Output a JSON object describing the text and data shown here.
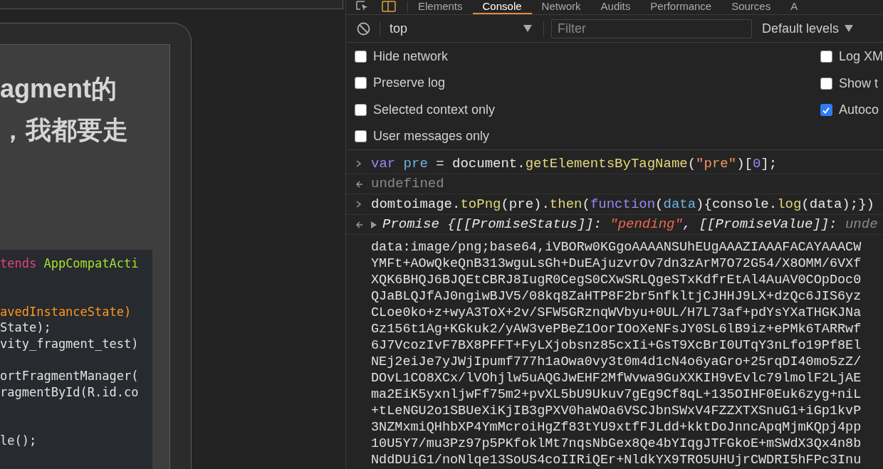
{
  "preview": {
    "heading_lines": [
      "agment的",
      "，我都要走"
    ],
    "code_lines": [
      {
        "kind": "code",
        "tokens": [
          {
            "kind": "keyword",
            "text": "tends "
          },
          {
            "kind": "type",
            "text": "AppCompatActi"
          }
        ]
      },
      {
        "kind": "blank"
      },
      {
        "kind": "blank"
      },
      {
        "kind": "code",
        "tokens": [
          {
            "kind": "param",
            "text": "avedInstanceState)"
          }
        ]
      },
      {
        "kind": "code",
        "tokens": [
          {
            "kind": "plain",
            "text": "State);"
          }
        ]
      },
      {
        "kind": "code",
        "tokens": [
          {
            "kind": "plain",
            "text": "vity_fragment_test)"
          }
        ]
      },
      {
        "kind": "blank"
      },
      {
        "kind": "code",
        "tokens": [
          {
            "kind": "plain",
            "text": "ortFragmentManager("
          }
        ]
      },
      {
        "kind": "code",
        "tokens": [
          {
            "kind": "plain",
            "text": "ragmentById(R.id.co"
          }
        ]
      },
      {
        "kind": "blank"
      },
      {
        "kind": "blank"
      },
      {
        "kind": "code",
        "tokens": [
          {
            "kind": "plain",
            "text": "le();"
          }
        ]
      }
    ]
  },
  "devtools": {
    "tabs": [
      {
        "label": "Elements",
        "selected": false
      },
      {
        "label": "Console",
        "selected": true
      },
      {
        "label": "Network",
        "selected": false
      },
      {
        "label": "Audits",
        "selected": false
      },
      {
        "label": "Performance",
        "selected": false
      },
      {
        "label": "Sources",
        "selected": false
      },
      {
        "label": "A",
        "selected": false
      }
    ],
    "toolbar": {
      "context": "top",
      "filter_placeholder": "Filter",
      "levels": "Default levels"
    },
    "settings_left": [
      {
        "label": "Hide network",
        "checked": false
      },
      {
        "label": "Preserve log",
        "checked": false
      },
      {
        "label": "Selected context only",
        "checked": false
      },
      {
        "label": "User messages only",
        "checked": false
      }
    ],
    "settings_right": [
      {
        "label": "Log XM",
        "checked": false
      },
      {
        "label": "Show t",
        "checked": false
      },
      {
        "label": "Autoco",
        "checked": true
      }
    ],
    "console": [
      {
        "kind": "input",
        "tokens": [
          {
            "kind": "keyword",
            "text": "var "
          },
          {
            "kind": "variable",
            "text": "pre"
          },
          {
            "kind": "plain",
            "text": " = document."
          },
          {
            "kind": "method",
            "text": "getElementsByTagName"
          },
          {
            "kind": "plain",
            "text": "("
          },
          {
            "kind": "string",
            "text": "\"pre\""
          },
          {
            "kind": "plain",
            "text": ")["
          },
          {
            "kind": "number",
            "text": "0"
          },
          {
            "kind": "plain",
            "text": "];"
          }
        ]
      },
      {
        "kind": "result",
        "tokens": [
          {
            "kind": "muted",
            "text": "undefined"
          }
        ]
      },
      {
        "kind": "input",
        "tokens": [
          {
            "kind": "plain",
            "text": "domtoimage."
          },
          {
            "kind": "method",
            "text": "toPng"
          },
          {
            "kind": "plain",
            "text": "(pre)."
          },
          {
            "kind": "method",
            "text": "then"
          },
          {
            "kind": "plain",
            "text": "("
          },
          {
            "kind": "keyword",
            "text": "function"
          },
          {
            "kind": "plain",
            "text": "("
          },
          {
            "kind": "variable",
            "text": "data"
          },
          {
            "kind": "plain",
            "text": "){console."
          },
          {
            "kind": "method",
            "text": "log"
          },
          {
            "kind": "plain",
            "text": "(data);})"
          }
        ]
      },
      {
        "kind": "promise",
        "tokens": [
          {
            "kind": "plain",
            "text": "Promise {[[PromiseStatus]]: "
          },
          {
            "kind": "status",
            "text": "\"pending\""
          },
          {
            "kind": "plain",
            "text": ", [[PromiseValue]]: "
          },
          {
            "kind": "muted",
            "text": "unde"
          }
        ]
      }
    ],
    "log_lines": [
      "data:image/png;base64,iVBORw0KGgoAAAANSUhEUgAAAZIAAAFACAYAAACW",
      "YMFt+AOwQkeQnB313wguLsGh+DuEAjuzvrOv7dn3zArM7O72G54/X8OMM/6VXf",
      "XQK6BHQJ6BJQEtCBRJ8IugR0CegS0CXwSRLQgeSTxKdfrEtAl4AuAV0COpDoc0",
      "QJaBLQJfAJ0ngiwBJV5/08kq8ZaHTP8F2br5nfkltjCJHHJ9LX+dzQc6JIS6yz",
      "CLoe0ko+z+wyA3ToX+2v/SFW5GRznqWVbyu+0UL/H7L73af+pdYsYXaTHGKJNa",
      "Gz156t1Ag+KGkuk2/yAW3vePBeZ1OorIOoXeNFsJY0SL6lB9iz+ePMk6TARRwf",
      "6J7VcozIvF7BX8PFFT+FyLXjobsnz85cxIi+GsT9XcBrI0UTqY3nLfo19Pf8El",
      "NEj2eiJe7yJWjIpumf777h1aOwa0vy3t0m4d1cN4o6yaGro+25rqDI40mo5zZ/",
      "DOvL1CO8XCx/lVOhjlw5uAQGJwEHF2MfWvwa9GuXXKIH9vEvlc79lmolF2LjAE",
      "ma2EiK5yxnljwFf75m2+pvXL5bU9Ukuv7gEg9Cf8qL+135OIHF0Euk6zyg+niL",
      "+tLeNGU2o1SBUeXiKjIB3gPXV0haWOa6VSCJbnSWxV4FZZXTXSnuG1+iGp1kvP",
      "3NZMxmiQHhbXP4YmMcroiHgZf83tYU9xtfFJLdd+kktDoJnncApqMjmKQpj4pp",
      "10U5Y7/mu3Pz97p5PKfoklMt7nqsNbGex8Qe4bYIqgJTFGkoE+mSWdX3Qx4n8b",
      "NddDUiG1/noNlqe13SoUS4coIIRiQEr+NldkYX9TRO5UHUjrCWDRI5hFPc3Inu"
    ]
  }
}
